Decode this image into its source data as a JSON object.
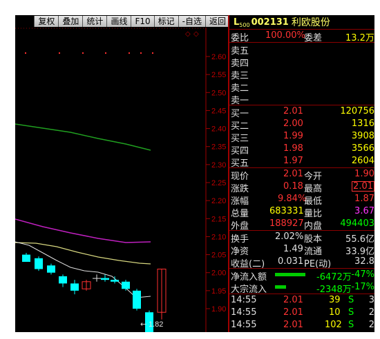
{
  "toolbar": {
    "buttons": [
      "复权",
      "叠加",
      "统计",
      "画线",
      "F10",
      "标记",
      "-自选",
      "返回"
    ]
  },
  "chart": {
    "price_ticks": [
      "2.60",
      "2.55",
      "2.50",
      "2.45",
      "2.40",
      "2.35",
      "2.30",
      "2.25",
      "2.20",
      "2.15",
      "2.10",
      "2.05",
      "2.00",
      "1.95",
      "1.90"
    ],
    "low_label": "1.82",
    "colors": {
      "up": "#ff3030",
      "down": "#00ffff",
      "ma_green": "#20a020",
      "ma_magenta": "#c020c0",
      "ma_yellow": "#d8d880",
      "ma_white": "#e0e0e0"
    }
  },
  "header": {
    "prefix": "L",
    "sub": "500",
    "code": "002131",
    "name": "利欧股份"
  },
  "commission": {
    "ratio_label": "委比",
    "ratio": "100.00%",
    "diff_label": "委差",
    "diff": "13.2万"
  },
  "asks": [
    {
      "label": "卖五",
      "price": "",
      "vol": ""
    },
    {
      "label": "卖四",
      "price": "",
      "vol": ""
    },
    {
      "label": "卖三",
      "price": "",
      "vol": ""
    },
    {
      "label": "卖二",
      "price": "",
      "vol": ""
    },
    {
      "label": "卖一",
      "price": "",
      "vol": ""
    }
  ],
  "bids": [
    {
      "label": "买一",
      "price": "2.01",
      "vol": "120756"
    },
    {
      "label": "买二",
      "price": "2.00",
      "vol": "1316"
    },
    {
      "label": "买三",
      "price": "1.99",
      "vol": "3908"
    },
    {
      "label": "买四",
      "price": "1.98",
      "vol": "3566"
    },
    {
      "label": "买五",
      "price": "1.97",
      "vol": "2604"
    }
  ],
  "quote": [
    {
      "l1": "现价",
      "v1": "2.01",
      "l2": "今开",
      "v2": "1.90"
    },
    {
      "l1": "涨跌",
      "v1": "0.18",
      "l2": "最高",
      "v2": "2.01"
    },
    {
      "l1": "涨幅",
      "v1": "9.84%",
      "l2": "最低",
      "v2": "1.87"
    },
    {
      "l1": "总量",
      "v1": "683331",
      "l2": "量比",
      "v2": "3.67"
    },
    {
      "l1": "外盘",
      "v1": "188927",
      "l2": "内盘",
      "v2": "494403"
    }
  ],
  "fundamentals": [
    {
      "l1": "换手",
      "v1": "2.02%",
      "l2": "股本",
      "v2": "55.6亿"
    },
    {
      "l1": "净资",
      "v1": "1.49",
      "l2": "流通",
      "v2": "33.9亿"
    },
    {
      "l1": "收益(二)",
      "v1": "0.031",
      "l2": "PE(动)",
      "v2": "32.8"
    }
  ],
  "flows": [
    {
      "label": "净流入额",
      "amount": "-6472万",
      "pct": "-47%",
      "bar": 0.85
    },
    {
      "label": "大宗流入",
      "amount": "-2348万",
      "pct": "-17%",
      "bar": 0.3
    }
  ],
  "ticks": [
    {
      "time": "14:55",
      "price": "2.01",
      "vol": "39",
      "side": "S",
      "n": "3"
    },
    {
      "time": "14:55",
      "price": "2.01",
      "vol": "10",
      "side": "S",
      "n": "2"
    },
    {
      "time": "14:55",
      "price": "2.01",
      "vol": "102",
      "side": "S",
      "n": "2"
    }
  ]
}
